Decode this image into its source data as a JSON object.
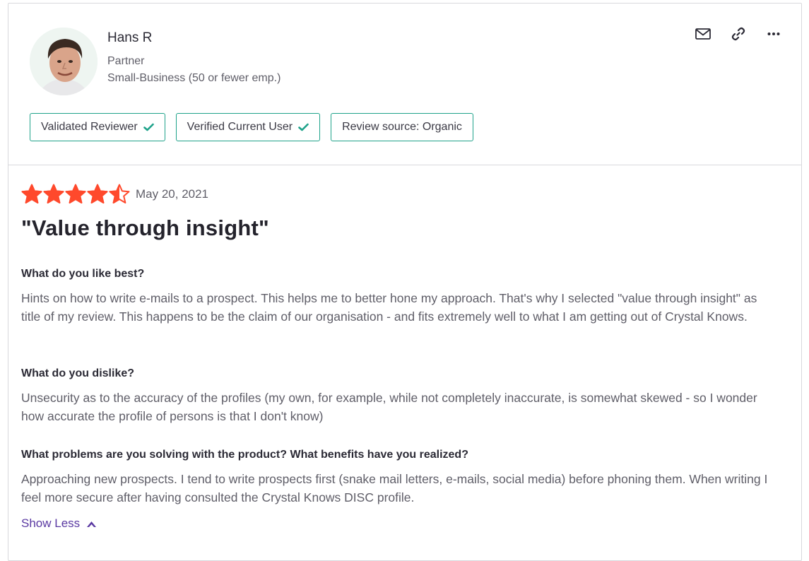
{
  "reviewer": {
    "name": "Hans R",
    "role": "Partner",
    "company": "Small-Business (50 or fewer emp.)"
  },
  "actions": [
    {
      "icon": "mail-icon"
    },
    {
      "icon": "link-icon"
    },
    {
      "icon": "more-icon"
    }
  ],
  "badges": [
    {
      "label": "Validated Reviewer",
      "checked": true
    },
    {
      "label": "Verified Current User",
      "checked": true
    },
    {
      "label": "Review source: Organic",
      "checked": false
    }
  ],
  "review": {
    "rating": 4.5,
    "max_rating": 5,
    "star_color": "#ff492c",
    "date": "May 20, 2021",
    "title": "\"Value through insight\"",
    "sections": [
      {
        "question": "What do you like best?",
        "answer": "Hints on how to write e-mails to a prospect. This helps me to better hone my approach. That's why I selected \"value through insight\" as title of my review. This happens to be the claim of our organisation - and fits extremely well to what I am getting out of Crystal Knows."
      },
      {
        "question": "What do you dislike?",
        "answer": "Unsecurity as to the accuracy of the profiles (my own, for example, while not completely inaccurate, is somewhat skewed - so I wonder how accurate the profile of persons is that I don't know)"
      },
      {
        "question": "What problems are you solving with the product? What benefits have you realized?",
        "answer": "Approaching new prospects. I tend to write prospects first (snake mail letters, e-mails, social media) before phoning them. When writing I feel more secure after having consulted the Crystal Knows DISC profile."
      }
    ],
    "show_less_label": "Show Less"
  },
  "colors": {
    "badge_border": "#1ea28a",
    "check": "#1ea28a",
    "link": "#5a39a2"
  }
}
